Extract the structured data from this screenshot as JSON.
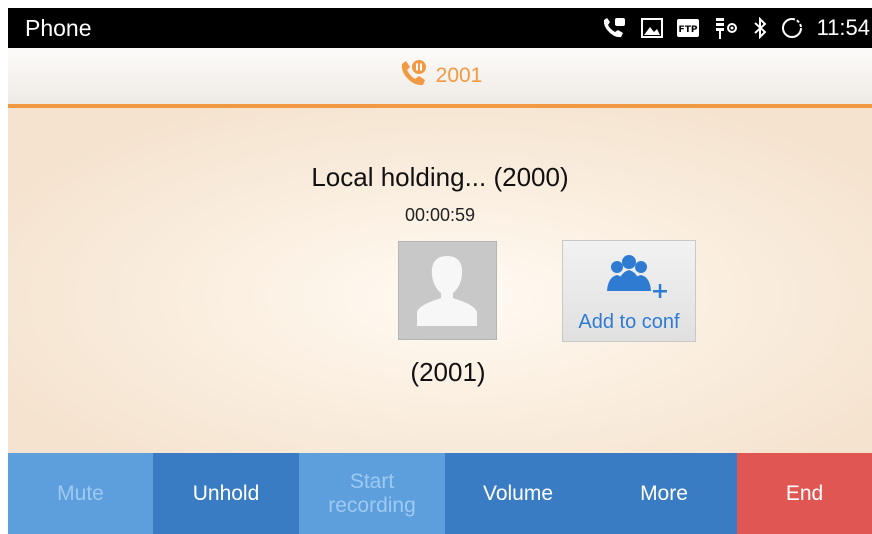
{
  "statusbar": {
    "app_title": "Phone",
    "time": "11:54",
    "icons": [
      "call-notification-icon",
      "image-icon",
      "ftp-icon",
      "usb-debug-icon",
      "bluetooth-icon",
      "sync-icon"
    ]
  },
  "callbar": {
    "icon": "call-hold-icon",
    "number": "2001",
    "accent": "#f29a43"
  },
  "call": {
    "status": "Local holding... (2000)",
    "duration": "00:00:59",
    "avatar_icon": "person-icon",
    "caller": "(2001)"
  },
  "conference": {
    "label": "Add to conf",
    "icon": "add-group-icon"
  },
  "toolbar": {
    "mute_label": "Mute",
    "unhold_label": "Unhold",
    "record_label": "Start recording",
    "volume_label": "Volume",
    "more_label": "More",
    "end_label": "End",
    "colors": {
      "enabled": "#3a7cc4",
      "disabled": "#5d9fdd",
      "end": "#e05652"
    }
  }
}
